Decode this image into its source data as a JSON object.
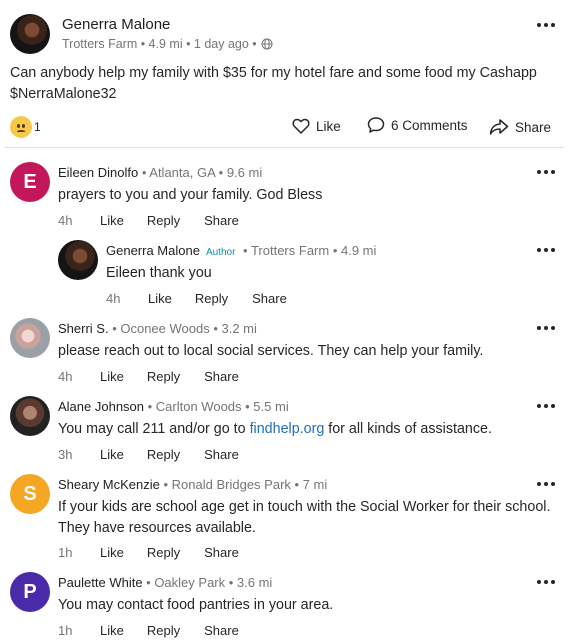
{
  "post": {
    "author": "Generra Malone",
    "meta": "Trotters Farm • 4.9 mi • 1 day ago •",
    "body": "Can anybody help my family with $35 for my hotel fare and some food my Cashapp $NerraMalone32",
    "reaction_count": "1",
    "like_label": "Like",
    "comments_label": "6 Comments",
    "share_label": "Share"
  },
  "comments": [
    {
      "name": "Eileen Dinolfo",
      "meta": " • Atlanta, GA • 9.6 mi",
      "avatar_letter": "E",
      "avatar_color": "#c2185b",
      "text": "prayers to you and your family. God Bless",
      "time": "4h",
      "like": "Like",
      "reply": "Reply",
      "share": "Share"
    },
    {
      "name": "Generra Malone",
      "badge": "Author",
      "meta": " • Trotters Farm • 4.9 mi",
      "mention": "Eileen",
      "text": " thank you",
      "time": "4h",
      "like": "Like",
      "reply": "Reply",
      "share": "Share"
    },
    {
      "name": "Sherri S.",
      "meta": " • Oconee Woods • 3.2 mi",
      "text": "please reach out to local social services.  They can help your family.",
      "time": "4h",
      "like": "Like",
      "reply": "Reply",
      "share": "Share"
    },
    {
      "name": "Alane Johnson",
      "meta": " • Carlton Woods • 5.5 mi",
      "text_pre": "You may call 211 and/or go to ",
      "link": "findhelp.org",
      "text_post": " for all kinds of assistance.",
      "time": "3h",
      "like": "Like",
      "reply": "Reply",
      "share": "Share"
    },
    {
      "name": "Sheary McKenzie",
      "meta": " • Ronald Bridges Park • 7 mi",
      "avatar_letter": "S",
      "avatar_color": "#f5a623",
      "text": "If your kids are school age get in touch with the Social Worker for their school. They have resources available.",
      "time": "1h",
      "like": "Like",
      "reply": "Reply",
      "share": "Share"
    },
    {
      "name": "Paulette White",
      "meta": " • Oakley Park • 3.6 mi",
      "avatar_letter": "P",
      "avatar_color": "#4a2aa8",
      "text": "You may contact food pantries in your area.",
      "time": "1h",
      "like": "Like",
      "reply": "Reply",
      "share": "Share"
    }
  ]
}
